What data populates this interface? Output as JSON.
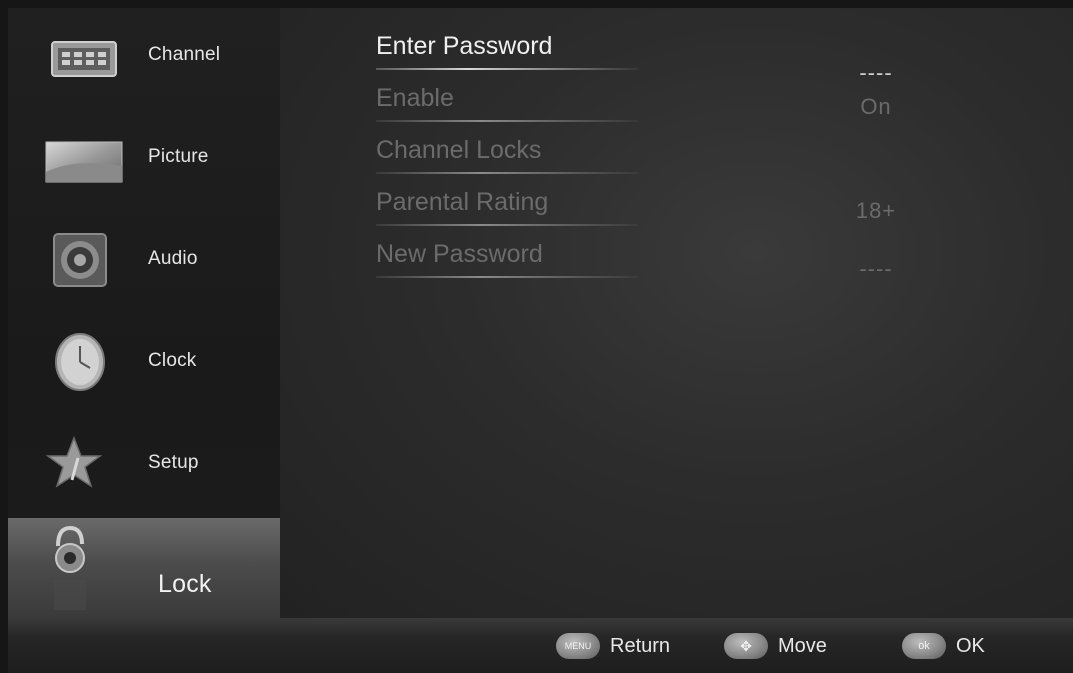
{
  "sidebar": {
    "items": [
      {
        "label": "Channel"
      },
      {
        "label": "Picture"
      },
      {
        "label": "Audio"
      },
      {
        "label": "Clock"
      },
      {
        "label": "Setup"
      },
      {
        "label": "Lock"
      }
    ],
    "active_index": 5
  },
  "lock_menu": {
    "rows": [
      {
        "label": "Enter Password",
        "value": "----"
      },
      {
        "label": "Enable",
        "value": "On"
      },
      {
        "label": "Channel Locks",
        "value": ""
      },
      {
        "label": "Parental Rating",
        "value": "18+"
      },
      {
        "label": "New Password",
        "value": "----"
      }
    ],
    "active_index": 0
  },
  "footer": {
    "hints": [
      {
        "button": "MENU",
        "label": "Return"
      },
      {
        "button": "✥",
        "label": "Move"
      },
      {
        "button": "ok",
        "label": "OK"
      }
    ]
  },
  "colors": {
    "background": "#161616",
    "active_text": "#f0f0f0",
    "inactive_text": "#6b6b6b"
  },
  "icons": [
    "channel-icon",
    "picture-icon",
    "audio-speaker-icon",
    "clock-icon",
    "setup-star-icon",
    "padlock-icon"
  ]
}
